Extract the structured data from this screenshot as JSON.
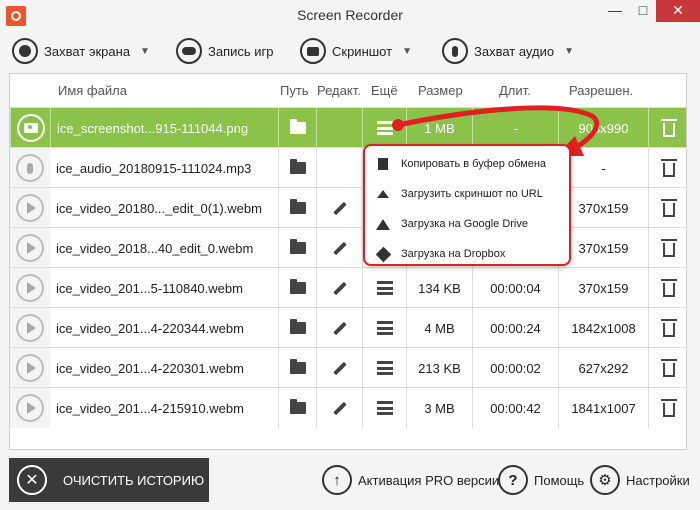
{
  "window": {
    "title": "Screen Recorder",
    "min": "—",
    "max": "□",
    "close": "✕"
  },
  "toolbar": {
    "capture_screen": "Захват экрана",
    "game_record": "Запись игр",
    "screenshot": "Скриншот",
    "capture_audio": "Захват аудио"
  },
  "table": {
    "headers": {
      "name": "Имя файла",
      "path": "Путь",
      "edit": "Редакт.",
      "more": "Ещё",
      "size": "Размер",
      "duration": "Длит.",
      "resolution": "Разрешен."
    },
    "rows": [
      {
        "type": "camera-icon",
        "name": "ice_screenshot...915-111044.png",
        "size": "1 MB",
        "duration": "-",
        "resolution": "903x990",
        "editable": false,
        "selected": true
      },
      {
        "type": "mic-icon",
        "name": "ice_audio_20180915-111024.mp3",
        "size": "",
        "duration": "",
        "resolution": "-",
        "editable": false,
        "selected": false
      },
      {
        "type": "play-icon",
        "name": "ice_video_20180..._edit_0(1).webm",
        "size": "",
        "duration": "",
        "resolution": "370x159",
        "editable": true,
        "selected": false
      },
      {
        "type": "play-icon",
        "name": "ice_video_2018...40_edit_0.webm",
        "size": "",
        "duration": "",
        "resolution": "370x159",
        "editable": true,
        "selected": false
      },
      {
        "type": "play-icon",
        "name": "ice_video_201...5-110840.webm",
        "size": "134 KB",
        "duration": "00:00:04",
        "resolution": "370x159",
        "editable": true,
        "selected": false
      },
      {
        "type": "play-icon",
        "name": "ice_video_201...4-220344.webm",
        "size": "4 MB",
        "duration": "00:00:24",
        "resolution": "1842x1008",
        "editable": true,
        "selected": false
      },
      {
        "type": "play-icon",
        "name": "ice_video_201...4-220301.webm",
        "size": "213 KB",
        "duration": "00:00:02",
        "resolution": "627x292",
        "editable": true,
        "selected": false
      },
      {
        "type": "play-icon",
        "name": "ice_video_201...4-215910.webm",
        "size": "3 MB",
        "duration": "00:00:42",
        "resolution": "1841x1007",
        "editable": true,
        "selected": false
      }
    ]
  },
  "popup_menu": {
    "items": [
      {
        "label": "Копировать в буфер обмена",
        "icon": "copy-icon"
      },
      {
        "label": "Загрузить скриншот по URL",
        "icon": "upload-icon"
      },
      {
        "label": "Загрузка на Google Drive",
        "icon": "google-drive-icon"
      },
      {
        "label": "Загрузка на Dropbox",
        "icon": "dropbox-icon"
      }
    ]
  },
  "bottom": {
    "clear_history": "ОЧИСТИТЬ ИСТОРИЮ",
    "pro_activation": "Активация PRO версии",
    "help": "Помощь",
    "settings": "Настройки"
  },
  "colors": {
    "selected_row": "#8bc34a",
    "annotation": "#e02020",
    "close_button": "#c7383c"
  }
}
